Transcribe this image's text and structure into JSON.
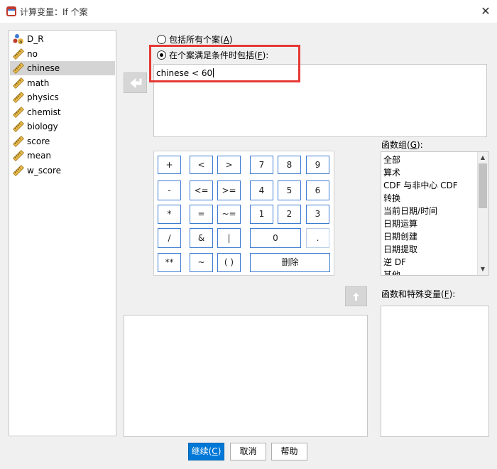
{
  "window": {
    "title": "计算变量：If 个案",
    "close_glyph": "✕"
  },
  "variables": [
    {
      "name": "D_R",
      "icon": "nominal-icon",
      "selected": false
    },
    {
      "name": "no",
      "icon": "scale-ruler-icon",
      "selected": false
    },
    {
      "name": "chinese",
      "icon": "scale-ruler-icon",
      "selected": true
    },
    {
      "name": "math",
      "icon": "scale-ruler-icon",
      "selected": false
    },
    {
      "name": "physics",
      "icon": "scale-ruler-icon",
      "selected": false
    },
    {
      "name": "chemist",
      "icon": "scale-ruler-icon",
      "selected": false
    },
    {
      "name": "biology",
      "icon": "scale-ruler-icon",
      "selected": false
    },
    {
      "name": "score",
      "icon": "scale-ruler-icon",
      "selected": false
    },
    {
      "name": "mean",
      "icon": "scale-ruler-icon",
      "selected": false
    },
    {
      "name": "w_score",
      "icon": "scale-ruler-icon",
      "selected": false
    }
  ],
  "radio_all": {
    "label_pre": "包括所有个案(",
    "mnemonic": "A",
    "label_post": ")",
    "checked": false
  },
  "radio_cond": {
    "label_pre": "在个案满足条件时包括(",
    "mnemonic": "F",
    "label_post": "):",
    "checked": true
  },
  "condition": {
    "value": "chinese < 60"
  },
  "keypad": {
    "plus": "+",
    "lt": "<",
    "gt": ">",
    "d7": "7",
    "d8": "8",
    "d9": "9",
    "minus": "-",
    "le": "<=",
    "ge": ">=",
    "d4": "4",
    "d5": "5",
    "d6": "6",
    "mul": "*",
    "eq": "=",
    "ne": "~=",
    "d1": "1",
    "d2": "2",
    "d3": "3",
    "div": "/",
    "and": "&",
    "or": "|",
    "d0": "0",
    "dot": ".",
    "pow": "**",
    "not": "~",
    "paren": "( )",
    "delete": "删除"
  },
  "function_groups": {
    "label_pre": "函数组(",
    "mnemonic": "G",
    "label_post": "):",
    "items": [
      "全部",
      "算术",
      "CDF 与非中心 CDF",
      "转换",
      "当前日期/时间",
      "日期运算",
      "日期创建",
      "日期提取",
      "逆 DF",
      "其他"
    ]
  },
  "functions_special": {
    "label_pre": "函数和特殊变量(",
    "mnemonic": "F",
    "label_post": "):"
  },
  "buttons": {
    "continue_pre": "继续(",
    "continue_mn": "C",
    "continue_post": ")",
    "cancel": "取消",
    "help": "帮助"
  }
}
